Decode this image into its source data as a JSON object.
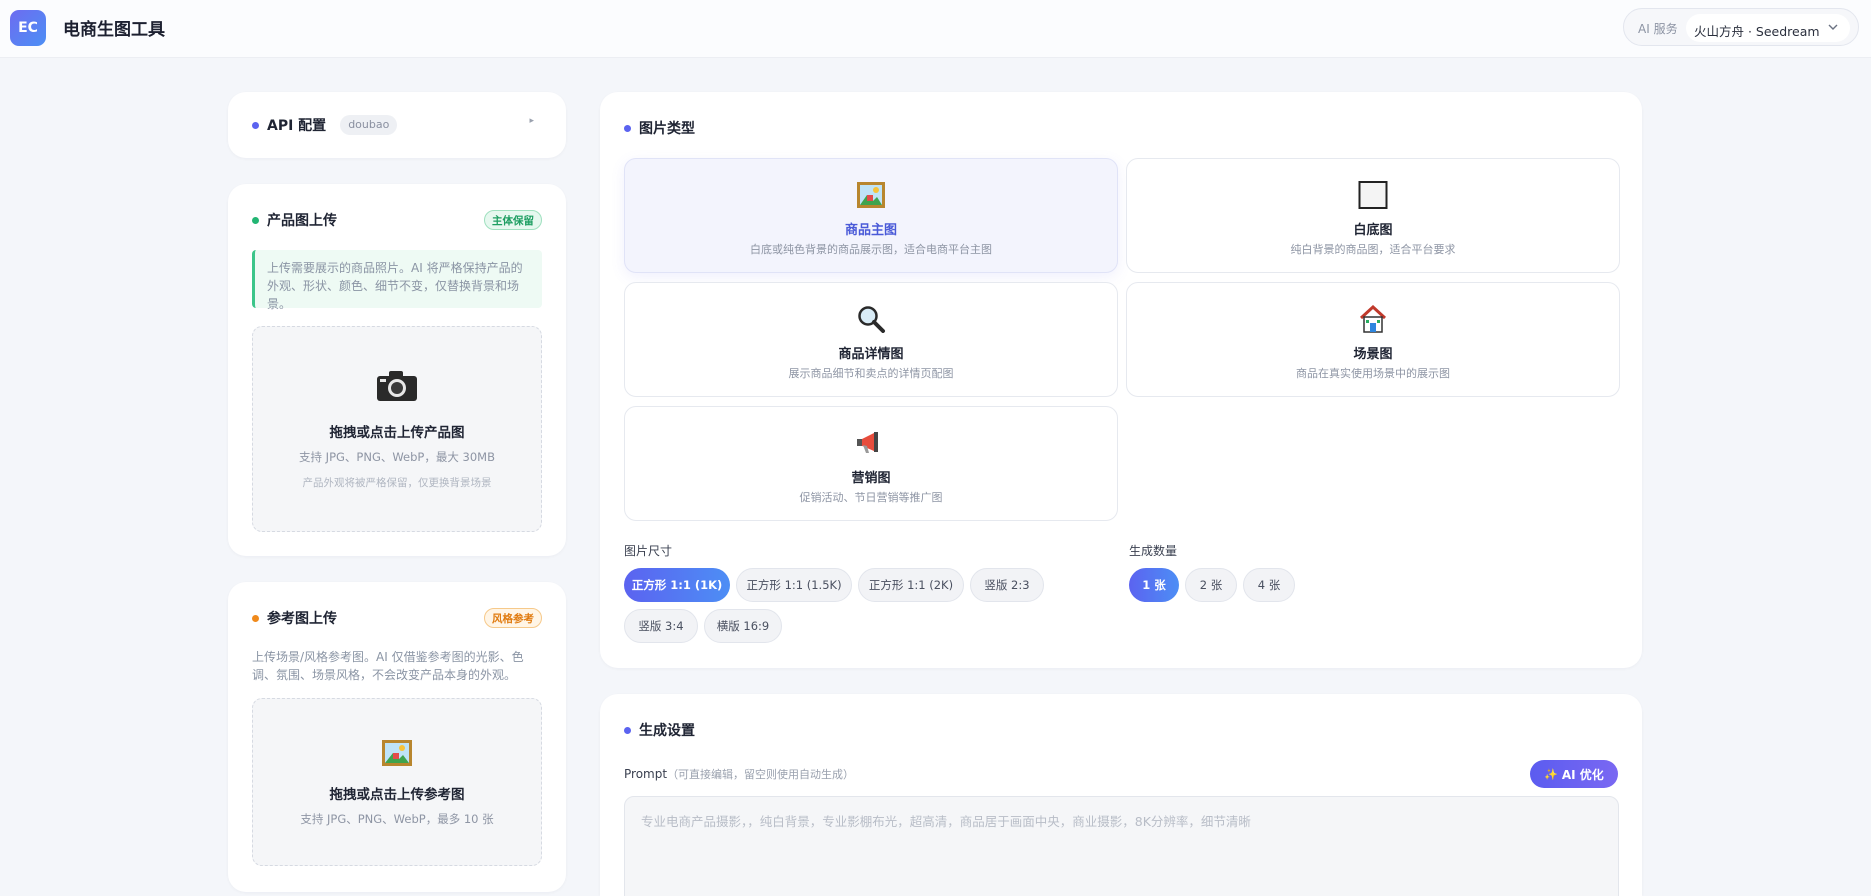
{
  "header": {
    "logo_text": "EC",
    "title": "电商生图工具",
    "service_label": "AI 服务",
    "service_value": "火山方舟 · Seedream"
  },
  "api_card": {
    "title": "API 配置",
    "tag": "doubao",
    "expand_icon": "triangle-right-icon"
  },
  "product_upload": {
    "title": "产品图上传",
    "badge": "主体保留",
    "note": "上传需要展示的商品照片。AI 将严格保持产品的外观、形状、颜色、细节不变，仅替换背景和场景。",
    "drop_icon": "camera-icon",
    "drop_title": "拖拽或点击上传产品图",
    "drop_sub": "支持 JPG、PNG、WebP，最大 30MB",
    "drop_hint": "产品外观将被严格保留，仅更换背景场景"
  },
  "reference_upload": {
    "title": "参考图上传",
    "badge": "风格参考",
    "note": "上传场景/风格参考图。AI 仅借鉴参考图的光影、色调、氛围、场景风格，不会改变产品本身的外观。",
    "drop_icon": "picture-icon",
    "drop_title": "拖拽或点击上传参考图",
    "drop_sub": "支持 JPG、PNG、WebP，最多 10 张"
  },
  "image_type": {
    "title": "图片类型",
    "options": [
      {
        "name": "商品主图",
        "desc": "白底或纯色背景的商品展示图，适合电商平台主图",
        "icon": "framed-picture-icon",
        "selected": true
      },
      {
        "name": "白底图",
        "desc": "纯白背景的商品图，适合平台要求",
        "icon": "white-square-icon",
        "selected": false
      },
      {
        "name": "商品详情图",
        "desc": "展示商品细节和卖点的详情页配图",
        "icon": "magnifier-icon",
        "selected": false
      },
      {
        "name": "场景图",
        "desc": "商品在真实使用场景中的展示图",
        "icon": "house-icon",
        "selected": false
      },
      {
        "name": "营销图",
        "desc": "促销活动、节日营销等推广图",
        "icon": "megaphone-icon",
        "selected": false
      }
    ],
    "size_label": "图片尺寸",
    "sizes": [
      "正方形 1:1 (1K)",
      "正方形 1:1 (1.5K)",
      "正方形 1:1 (2K)",
      "竖版 2:3",
      "竖版 3:4",
      "横版 16:9"
    ],
    "size_selected": "正方形 1:1 (1K)",
    "count_label": "生成数量",
    "counts": [
      "1 张",
      "2 张",
      "4 张"
    ],
    "count_selected": "1 张"
  },
  "generate": {
    "title": "生成设置",
    "prompt_label": "Prompt",
    "prompt_hint": "（可直接编辑，留空则使用自动生成）",
    "ai_button": "AI 优化",
    "ai_icon": "sparkle-icon",
    "prompt_placeholder": "专业电商产品摄影，，纯白背景，专业影棚布光，超高清，商品居于画面中央，商业摄影，8K分辨率，细节清晰"
  },
  "colors": {
    "accent": "#5b63f0",
    "green": "#22b573",
    "orange": "#f08a1c",
    "dot_blue": "#5b63f0"
  }
}
